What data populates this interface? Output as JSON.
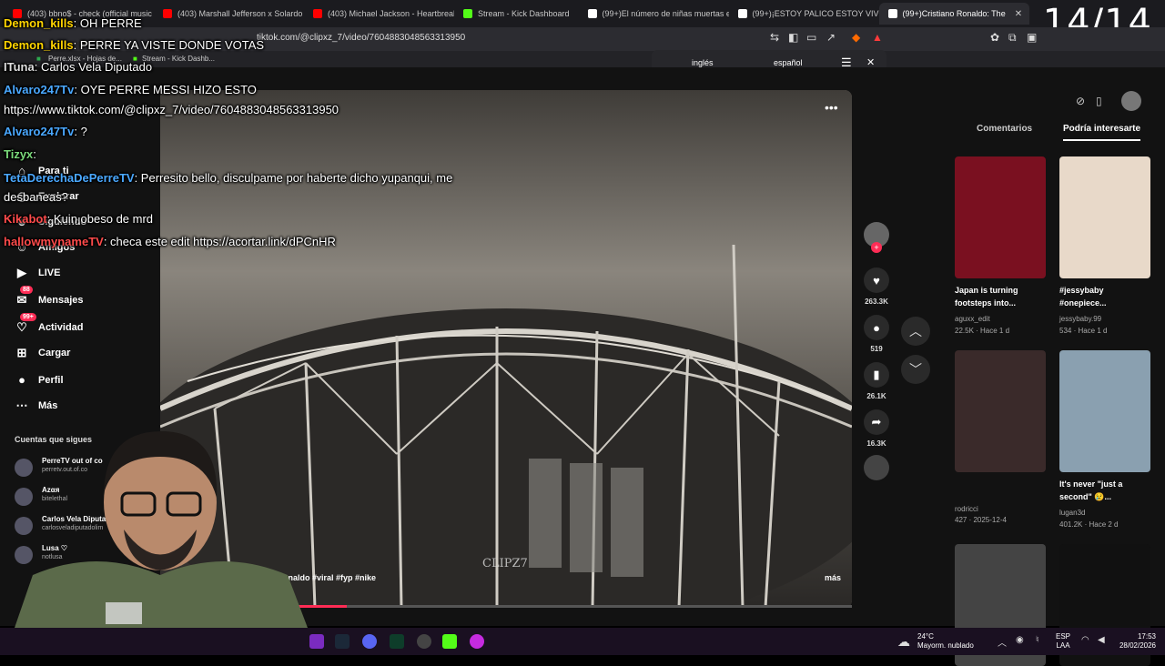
{
  "browser": {
    "tabs": [
      {
        "title": "(403) bbno$ - check (official music",
        "color": "#ff0000"
      },
      {
        "title": "(403) Marshall Jefferson x Solardo -",
        "color": "#ff0000"
      },
      {
        "title": "(403) Michael Jackson - Heartbreak",
        "color": "#ff0000"
      },
      {
        "title": "Stream - Kick Dashboard",
        "color": "#53fc18"
      },
      {
        "title": "(99+)El número de niñas muertas en",
        "color": "#ffffff"
      },
      {
        "title": "(99+)¡ESTOY PALICO ESTOY VIVO! |",
        "color": "#ffffff"
      },
      {
        "title": "(99+)Cristiano Ronaldo: The",
        "color": "#ffffff",
        "active": true
      }
    ],
    "url": "tiktok.com/@clipxz_7/video/7604883048563313950",
    "bookmarks": [
      "Perre.xlsx - Hojas de...",
      "Stream - Kick Dashb..."
    ],
    "counter": "14/14"
  },
  "translate": {
    "from": "inglés",
    "to": "español"
  },
  "sidebar": {
    "items": [
      {
        "label": "Para ti",
        "icon": "home-icon"
      },
      {
        "label": "Explorar",
        "icon": "compass-icon"
      },
      {
        "label": "Siguiendo",
        "icon": "users-icon"
      },
      {
        "label": "Amigos",
        "icon": "friends-icon"
      },
      {
        "label": "LIVE",
        "icon": "live-icon"
      },
      {
        "label": "Mensajes",
        "icon": "message-icon",
        "badge": "88"
      },
      {
        "label": "Actividad",
        "icon": "activity-icon",
        "badge": "99+"
      },
      {
        "label": "Cargar",
        "icon": "upload-icon"
      },
      {
        "label": "Perfil",
        "icon": "profile-icon"
      },
      {
        "label": "Más",
        "icon": "more-icon"
      }
    ],
    "following_header": "Cuentas que sigues",
    "following": [
      {
        "name": "PerreTV out of co",
        "handle": "perretv.out.of.co"
      },
      {
        "name": "Azαя",
        "handle": "bitelethal"
      },
      {
        "name": "Carlos Vela Diputad",
        "handle": "carlosveladiputadolim"
      },
      {
        "name": "Lusa ♡",
        "handle": "notlusa"
      }
    ]
  },
  "video": {
    "caption": "cristianoronaldo #viral #fyp #nike",
    "more": "más",
    "watermark": "CLIPZ7",
    "progress": 0.27,
    "likes": "263.3K",
    "comments": "519",
    "saves": "26.1K",
    "shares": "16.3K"
  },
  "right_panel": {
    "tabs": [
      "Comentarios",
      "Podría interesarte"
    ],
    "cards": [
      {
        "title": "Japan is turning footsteps into...",
        "user": "aguxx_edit",
        "stats": "22.5K · Hace 1 d",
        "bg": "#7a1020"
      },
      {
        "title": "#jessybaby #onepiece...",
        "user": "jessybaby.99",
        "stats": "534 · Hace 1 d",
        "bg": "#e8d9c9"
      },
      {
        "title": "",
        "user": "rodricci",
        "stats": "427 · 2025-12-4",
        "bg": "#3a2a2a"
      },
      {
        "title": "It's never \"just a second\" 😢...",
        "user": "lugan3d",
        "stats": "401.2K · Hace 2 d",
        "bg": "#8aa0b0"
      },
      {
        "title": "",
        "user": "",
        "stats": "",
        "bg": "#444"
      },
      {
        "title": "",
        "user": "",
        "stats": "",
        "bg": "#111"
      }
    ]
  },
  "chat": [
    {
      "user": "Demon_kills",
      "msg": "OH PERRE",
      "color": "#ffd400"
    },
    {
      "user": "Demon_kills",
      "msg": "PERRE YA VISTE DONDE VOTAS",
      "color": "#ffd400"
    },
    {
      "user": "ITuna",
      "msg": "Carlos Vela Diputado",
      "color": "#dddddd"
    },
    {
      "user": "Alvaro247Tv",
      "msg": "OYE PERRE MESSI HIZO ESTO",
      "color": "#4aa8ff"
    },
    {
      "user": "",
      "msg": "https://www.tiktok.com/@clipxz_7/video/7604883048563313950",
      "color": "#ffffff"
    },
    {
      "user": "Alvaro247Tv",
      "msg": "?",
      "color": "#4aa8ff"
    },
    {
      "user": "Tizyx",
      "msg": "",
      "color": "#7ad97a"
    },
    {
      "user": "TetaDerechaDePerreTV",
      "msg": "Perresito bello, disculpame por haberte dicho yupanqui, me",
      "color": "#4aa8ff"
    },
    {
      "user": "",
      "msg": "desbaneas?",
      "color": "#ffffff"
    },
    {
      "user": "Kikabot",
      "msg": "Kuin obeso de mrd",
      "color": "#ff4b4b"
    },
    {
      "user": "hallowmynameTV",
      "msg": "checa este edit https://acortar.link/dPCnHR",
      "color": "#ff4b4b"
    }
  ],
  "taskbar": {
    "weather_temp": "24°C",
    "weather_desc": "Mayorm. nublado",
    "lang": "ESP",
    "lang2": "LAA",
    "time": "17:53",
    "date": "28/02/2026"
  }
}
